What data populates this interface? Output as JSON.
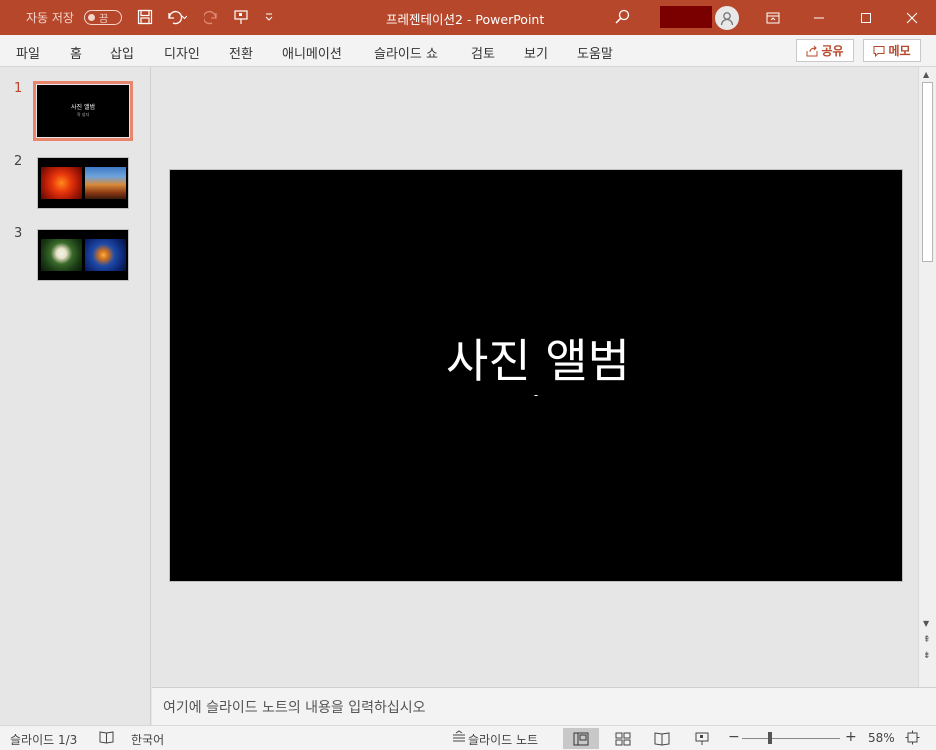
{
  "titlebar": {
    "autosave_label": "자동 저장",
    "autosave_state": "끔",
    "doc_title": "프레젠테이션2  -  PowerPoint"
  },
  "ribbon": {
    "tabs": [
      "파일",
      "홈",
      "삽입",
      "디자인",
      "전환",
      "애니메이션",
      "슬라이드 쇼",
      "검토",
      "보기",
      "도움말"
    ],
    "share_label": "공유",
    "memo_label": "메모"
  },
  "thumbnails": {
    "numbers": [
      "1",
      "2",
      "3"
    ],
    "slide1_title": "사진 앨범",
    "slide1_sub": "작 성자"
  },
  "slide": {
    "title": "사진 앨범",
    "subtitle": "-"
  },
  "notes": {
    "placeholder": "여기에 슬라이드 노트의 내용을 입력하십시오"
  },
  "statusbar": {
    "slide_counter": "슬라이드 1/3",
    "language": "한국어",
    "notes_label": "슬라이드 노트",
    "zoom": "58%"
  },
  "colors": {
    "accent": "#b7472a",
    "selected_outline": "#e8866d"
  }
}
